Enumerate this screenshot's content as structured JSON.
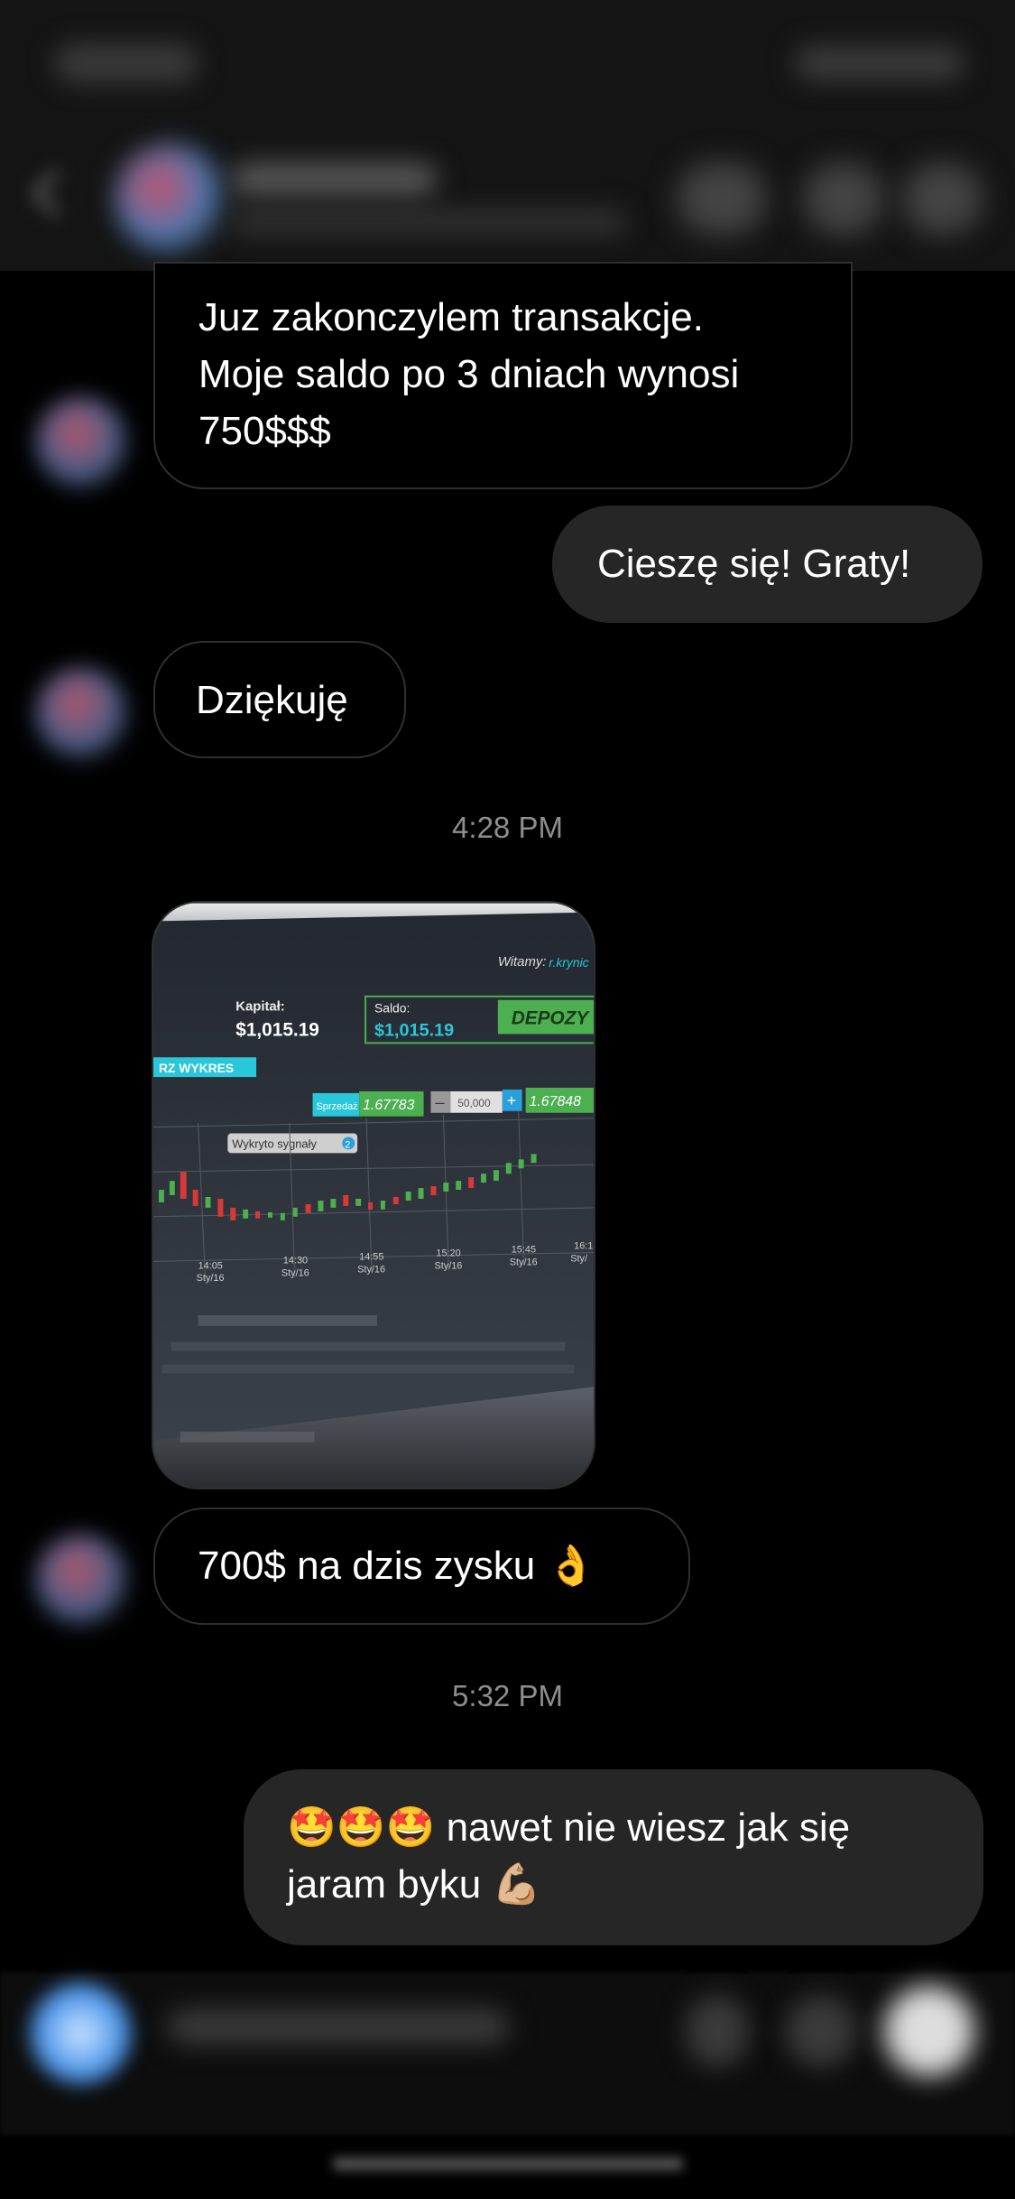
{
  "messages": {
    "m1": {
      "lines": "Juz zakonczylem transakcje.\nMoje saldo po 3 dniach wynosi\n750$$$"
    },
    "m2": {
      "text": "Cieszę się! Graty!"
    },
    "m3": {
      "text": "Dziękuję"
    },
    "ts1": "4:28 PM",
    "m4": {
      "text": "700$ na dzis zysku 👌"
    },
    "ts2": "5:32 PM",
    "m5": {
      "lines": "🤩🤩🤩 nawet nie wiesz jak się\njaram byku 💪🏼"
    }
  },
  "photo": {
    "welcome": "Witamy:",
    "user": "r.krynic",
    "kapital_label": "Kapitał:",
    "kapital_value": "$1,015.19",
    "saldo_label": "Saldo:",
    "saldo_value": "$1,015.19",
    "depozyt": "DEPOZY",
    "wykres": "RZ WYKRES",
    "sprzedaz": "Sprzedaż",
    "sell_price": "1.67783",
    "amount": "50,000",
    "buy_price": "1.67848",
    "signal": "Wykryto sygnały",
    "signal_count": "2",
    "times": [
      "14:05",
      "14:30",
      "14:55",
      "15:20",
      "15:45",
      "16:1"
    ],
    "dates": [
      "Sty/16",
      "Sty/16",
      "Sty/16",
      "Sty/16",
      "Sty/16",
      "Sty/"
    ],
    "colors": {
      "green": "#4caf50",
      "cyan": "#29c7d9",
      "red": "#d9383a"
    }
  }
}
